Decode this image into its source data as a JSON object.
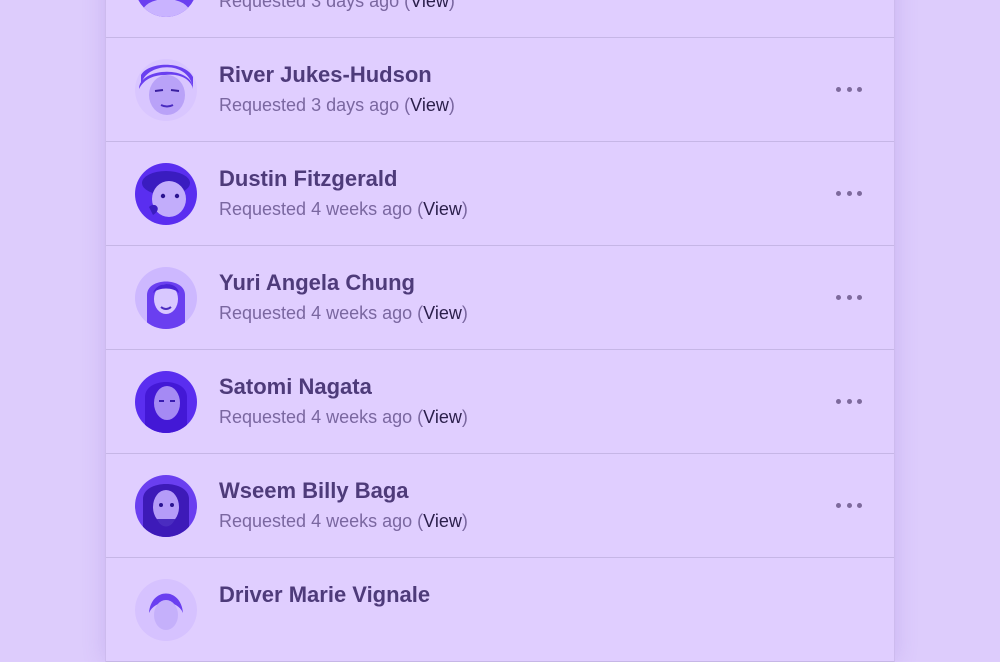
{
  "requests": [
    {
      "name": "",
      "requested": "Requested 3 days ago",
      "link_label": "View",
      "avatar_color": "#6a3ff0"
    },
    {
      "name": "River Jukes-Hudson",
      "requested": "Requested 3 days ago",
      "link_label": "View",
      "avatar_color": "#6a3ff0"
    },
    {
      "name": "Dustin Fitzgerald",
      "requested": "Requested 4 weeks ago",
      "link_label": "View",
      "avatar_color": "#5a2ef0"
    },
    {
      "name": "Yuri Angela Chung",
      "requested": "Requested 4 weeks ago",
      "link_label": "View",
      "avatar_color": "#6a3ff0"
    },
    {
      "name": "Satomi Nagata",
      "requested": "Requested 4 weeks ago",
      "link_label": "View",
      "avatar_color": "#5a2ef0"
    },
    {
      "name": "Wseem Billy Baga",
      "requested": "Requested 4 weeks ago",
      "link_label": "View",
      "avatar_color": "#6a3ff0"
    },
    {
      "name": "Driver Marie Vignale",
      "requested": "",
      "link_label": "",
      "avatar_color": "#6a3ff0"
    }
  ],
  "icons": {
    "row_menu": "more-horizontal-icon"
  }
}
